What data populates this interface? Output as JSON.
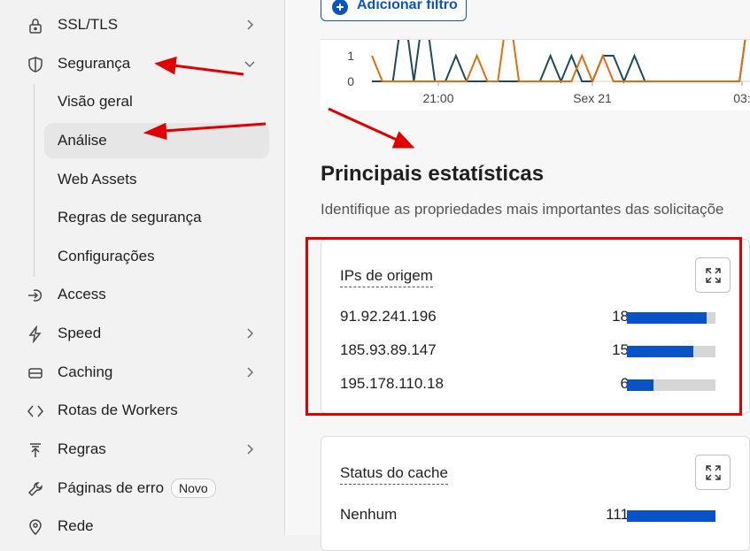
{
  "sidebar": {
    "items": [
      {
        "label": "SSL/TLS",
        "icon": "lock-icon",
        "chevron": "right"
      },
      {
        "label": "Segurança",
        "icon": "shield-icon",
        "chevron": "down"
      },
      {
        "label": "Access",
        "icon": "access-icon",
        "chevron": ""
      },
      {
        "label": "Speed",
        "icon": "bolt-icon",
        "chevron": "right"
      },
      {
        "label": "Caching",
        "icon": "storage-icon",
        "chevron": "right"
      },
      {
        "label": "Rotas de Workers",
        "icon": "workers-icon",
        "chevron": ""
      },
      {
        "label": "Regras",
        "icon": "rules-icon",
        "chevron": "right"
      },
      {
        "label": "Páginas de erro",
        "icon": "wrench-icon",
        "chevron": "",
        "badge": "Novo"
      },
      {
        "label": "Rede",
        "icon": "location-pin-icon",
        "chevron": ""
      }
    ],
    "security_subitems": [
      {
        "label": "Visão geral"
      },
      {
        "label": "Análise",
        "active": true
      },
      {
        "label": "Web Assets"
      },
      {
        "label": "Regras de segurança"
      },
      {
        "label": "Configurações"
      }
    ]
  },
  "toolbar": {
    "add_filter_label": "Adicionar filtro"
  },
  "chart_data": {
    "type": "line",
    "x_tick_labels": [
      "21:00",
      "Sex 21",
      "03:"
    ],
    "y_tick_labels": [
      "0",
      "1"
    ],
    "ylim": [
      0,
      2
    ],
    "series": [
      {
        "color": "#1e4b57",
        "values": [
          0,
          0,
          0,
          3,
          0,
          3,
          0,
          0,
          1,
          0,
          0,
          0,
          0,
          0,
          0,
          0,
          0,
          1,
          0,
          1,
          0,
          0,
          1,
          1,
          0,
          1,
          0,
          0,
          0,
          0,
          0,
          0,
          0,
          0,
          0,
          0,
          3
        ]
      },
      {
        "color": "#e06d10",
        "values": [
          1,
          0,
          0,
          0,
          0,
          0,
          0,
          0,
          0,
          0,
          1,
          0,
          0,
          3,
          0,
          0,
          0,
          0,
          0,
          0,
          1,
          0,
          1,
          0,
          0,
          0,
          0,
          0,
          0,
          0,
          0,
          0,
          0,
          0,
          0,
          0,
          3
        ]
      }
    ]
  },
  "main": {
    "section_title": "Principais estatísticas",
    "section_subtitle": "Identifique as propriedades mais importantes das solicitaçõe",
    "cards": [
      {
        "title": "IPs de origem",
        "max": 20,
        "rows": [
          {
            "key": "91.92.241.196",
            "value": "18",
            "num": 18
          },
          {
            "key": "185.93.89.147",
            "value": "15",
            "num": 15
          },
          {
            "key": "195.178.110.18",
            "value": "6",
            "num": 6
          }
        ]
      },
      {
        "title": "Status do cache",
        "max": 111,
        "rows": [
          {
            "key": "Nenhum",
            "value": "111",
            "num": 111
          }
        ]
      }
    ]
  },
  "colors": {
    "accent": "#0a53c6",
    "annotation": "#e00000",
    "bar_track": "#d6d6d6"
  }
}
